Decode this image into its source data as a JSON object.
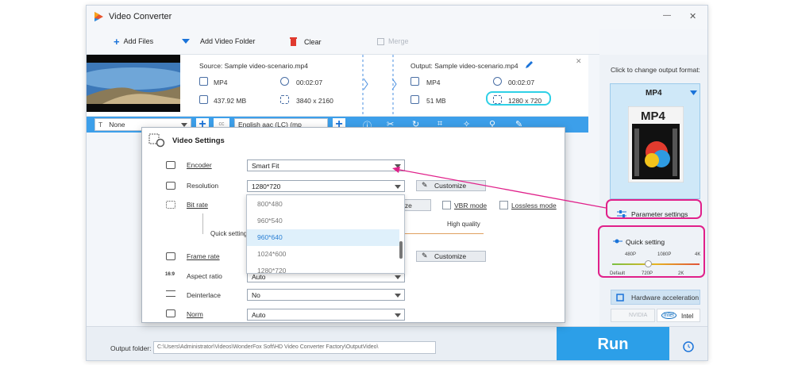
{
  "window": {
    "title": "Video Converter",
    "min_glyph": "—",
    "close_glyph": "✕"
  },
  "toolbar": {
    "add_files": "Add Files",
    "add_video_folder": "Add Video Folder",
    "clear": "Clear",
    "merge": "Merge"
  },
  "file": {
    "source_label": "Source: Sample video-scenario.mp4",
    "src_format": "MP4",
    "src_duration": "00:02:07",
    "src_size": "437.92 MB",
    "src_resolution": "3840 x 2160",
    "output_label": "Output: Sample video-scenario.mp4",
    "out_format": "MP4",
    "out_duration": "00:02:07",
    "out_size": "51 MB",
    "out_resolution": "1280 x 720"
  },
  "editbar": {
    "subtitle": "None",
    "audio": "English aac (LC) (mp",
    "subtitle_icon": "T"
  },
  "dialog": {
    "title": "Video Settings",
    "encoder_label": "Encoder",
    "encoder_value": "Smart Fit",
    "resolution_label": "Resolution",
    "resolution_value": "1280*720",
    "customize": "Customize",
    "customize2": "Customize",
    "bitrate_label": "Bit rate",
    "bitrate_btn_frag": "ize",
    "vbr_mode": "VBR mode",
    "lossless_mode": "Lossless mode",
    "quick_setting_frag": "Quick setting",
    "high_quality": "High quality",
    "framerate_label": "Frame rate",
    "aspect_label": "Aspect ratio",
    "aspect_value": "Auto",
    "aspect_icon_text": "16:9",
    "deinterlace_label": "Deinterlace",
    "deinterlace_value": "No",
    "norm_label": "Norm",
    "norm_value": "Auto"
  },
  "resolution_options": [
    "800*480",
    "960*540",
    "960*640",
    "1024*600",
    "1280*720"
  ],
  "right_panel": {
    "hint": "Click to change output format:",
    "format": "MP4",
    "format_icon_text": "MP4",
    "param_settings": "Parameter settings",
    "quick_setting": "Quick setting",
    "ticks_top": [
      "480P",
      "1080P",
      "4K"
    ],
    "ticks_bottom": [
      "Default",
      "720P",
      "2K"
    ],
    "hw_accel": "Hardware acceleration",
    "nvidia": "NVIDIA",
    "intel": "Intel",
    "intel_logo_text": "intel"
  },
  "bottom": {
    "output_folder_label": "Output folder:",
    "output_folder_path": "C:\\Users\\Administrator\\Videos\\WonderFox Soft\\HD Video Converter Factory\\OutputVideo\\",
    "run": "Run"
  },
  "colors": {
    "accent": "#1a73d9",
    "editbar": "#3c9fea",
    "run": "#2c9fe8",
    "highlight": "#e0208a",
    "cyan": "#2fd0e6"
  },
  "icons": [
    "app-logo-icon",
    "plus-icon",
    "folder-icon",
    "trash-icon",
    "merge-icon",
    "pencil-icon",
    "scissors-icon",
    "alarm-clock-icon"
  ]
}
